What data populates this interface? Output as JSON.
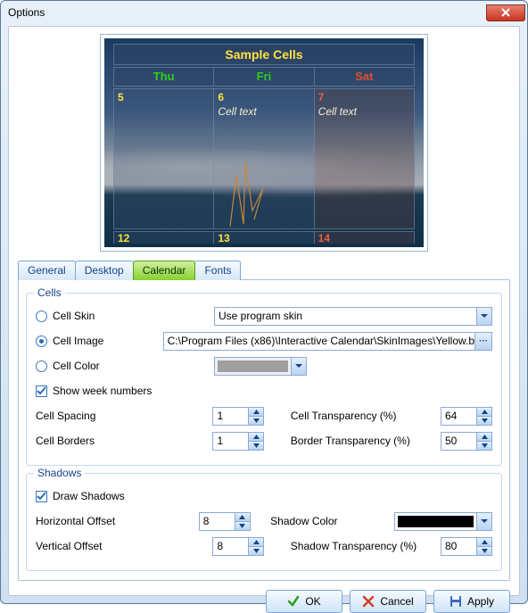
{
  "window": {
    "title": "Options"
  },
  "preview": {
    "title": "Sample Cells",
    "day_headers": [
      "Thu",
      "Fri",
      "Sat"
    ],
    "top_row": [
      {
        "num": "5",
        "text": ""
      },
      {
        "num": "6",
        "text": "Cell text"
      },
      {
        "num": "7",
        "text": "Cell text"
      }
    ],
    "bottom_row": [
      "12",
      "13",
      "14"
    ]
  },
  "tabs": {
    "general": "General",
    "desktop": "Desktop",
    "calendar": "Calendar",
    "fonts": "Fonts",
    "active": "calendar"
  },
  "cells_group": {
    "title": "Cells",
    "cell_skin_label": "Cell Skin",
    "cell_skin_value": "Use program skin",
    "cell_image_label": "Cell Image",
    "cell_image_value": "C:\\Program Files (x86)\\Interactive Calendar\\SkinImages\\Yellow.b",
    "cell_color_label": "Cell Color",
    "cell_color_value": "#a0a0a0",
    "show_week_label": "Show week numbers",
    "show_week_checked": true,
    "cell_spacing_label": "Cell Spacing",
    "cell_spacing_value": "1",
    "cell_borders_label": "Cell Borders",
    "cell_borders_value": "1",
    "cell_transparency_label": "Cell Transparency (%)",
    "cell_transparency_value": "64",
    "border_transparency_label": "Border Transparency (%)",
    "border_transparency_value": "50",
    "selected_radio": "cell_image"
  },
  "shadows_group": {
    "title": "Shadows",
    "draw_shadows_label": "Draw Shadows",
    "draw_shadows_checked": true,
    "horizontal_offset_label": "Horizontal Offset",
    "horizontal_offset_value": "8",
    "vertical_offset_label": "Vertical Offset",
    "vertical_offset_value": "8",
    "shadow_color_label": "Shadow Color",
    "shadow_color_value": "#000000",
    "shadow_transparency_label": "Shadow Transparency (%)",
    "shadow_transparency_value": "80"
  },
  "buttons": {
    "ok": "OK",
    "cancel": "Cancel",
    "apply": "Apply"
  }
}
